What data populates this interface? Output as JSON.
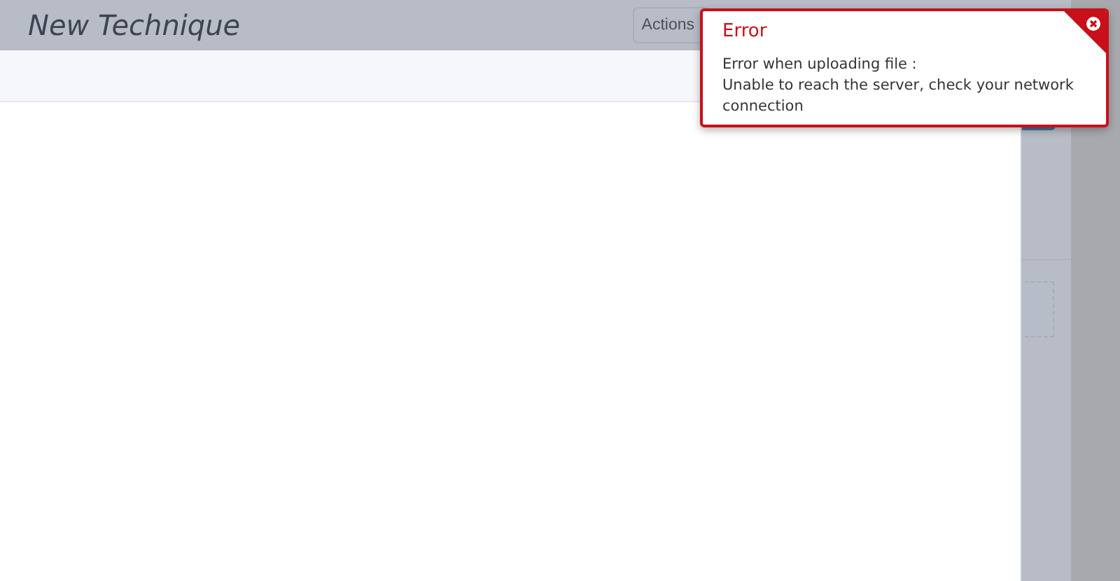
{
  "header": {
    "title": "New Technique",
    "actions_button": "Actions"
  },
  "toast": {
    "title": "Error",
    "lines": [
      "Error when uploading file :",
      "Unable to reach the server, check your network connection"
    ]
  }
}
